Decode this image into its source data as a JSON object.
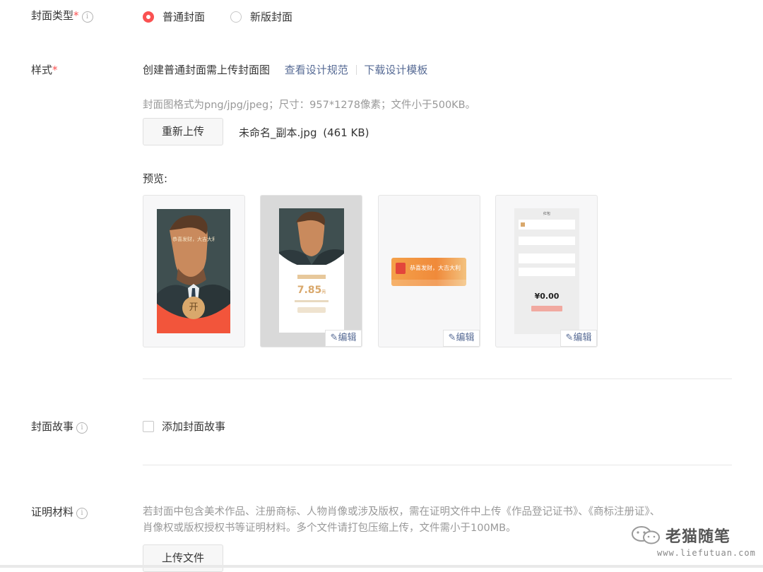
{
  "cover_type": {
    "label": "封面类型",
    "required_mark": "*",
    "info_icon": "info-icon",
    "options": [
      {
        "label": "普通封面",
        "selected": true
      },
      {
        "label": "新版封面",
        "selected": false
      }
    ]
  },
  "style": {
    "label": "样式",
    "required_mark": "*",
    "desc": "创建普通封面需上传封面图",
    "view_spec_link": "查看设计规范",
    "download_template_link": "下载设计模板",
    "format_hint": "封面图格式为png/jpg/jpeg；尺寸：957*1278像素；文件小于500KB。",
    "reupload_button": "重新上传",
    "file_name": "未命名_副本.jpg",
    "file_size": "(461 KB)"
  },
  "preview": {
    "label": "预览:",
    "edit_label": "编辑",
    "cover_greeting": "恭喜发财，大吉大利",
    "cover_logo_text": "开",
    "amount": "7.85",
    "amount_unit": "元",
    "detail_amount": "¥0.00",
    "detail_header": "红包"
  },
  "cover_story": {
    "label": "封面故事",
    "checkbox_label": "添加封面故事",
    "checked": false
  },
  "proof": {
    "label": "证明材料",
    "hint_line1": "若封面中包含美术作品、注册商标、人物肖像或涉及版权，需在证明文件中上传《作品登记证书》、《商标注册证》、",
    "hint_line2": "肖像权或版权授权书等证明材料。多个文件请打包压缩上传，文件需小于100MB。",
    "upload_button": "上传文件"
  },
  "watermark": {
    "name": "老猫随笔",
    "url": "www.liefutuan.com"
  },
  "colors": {
    "accent_red": "#fa5151",
    "link": "#576b95",
    "cover_red": "#f2553b",
    "gold": "#d9a86c"
  }
}
